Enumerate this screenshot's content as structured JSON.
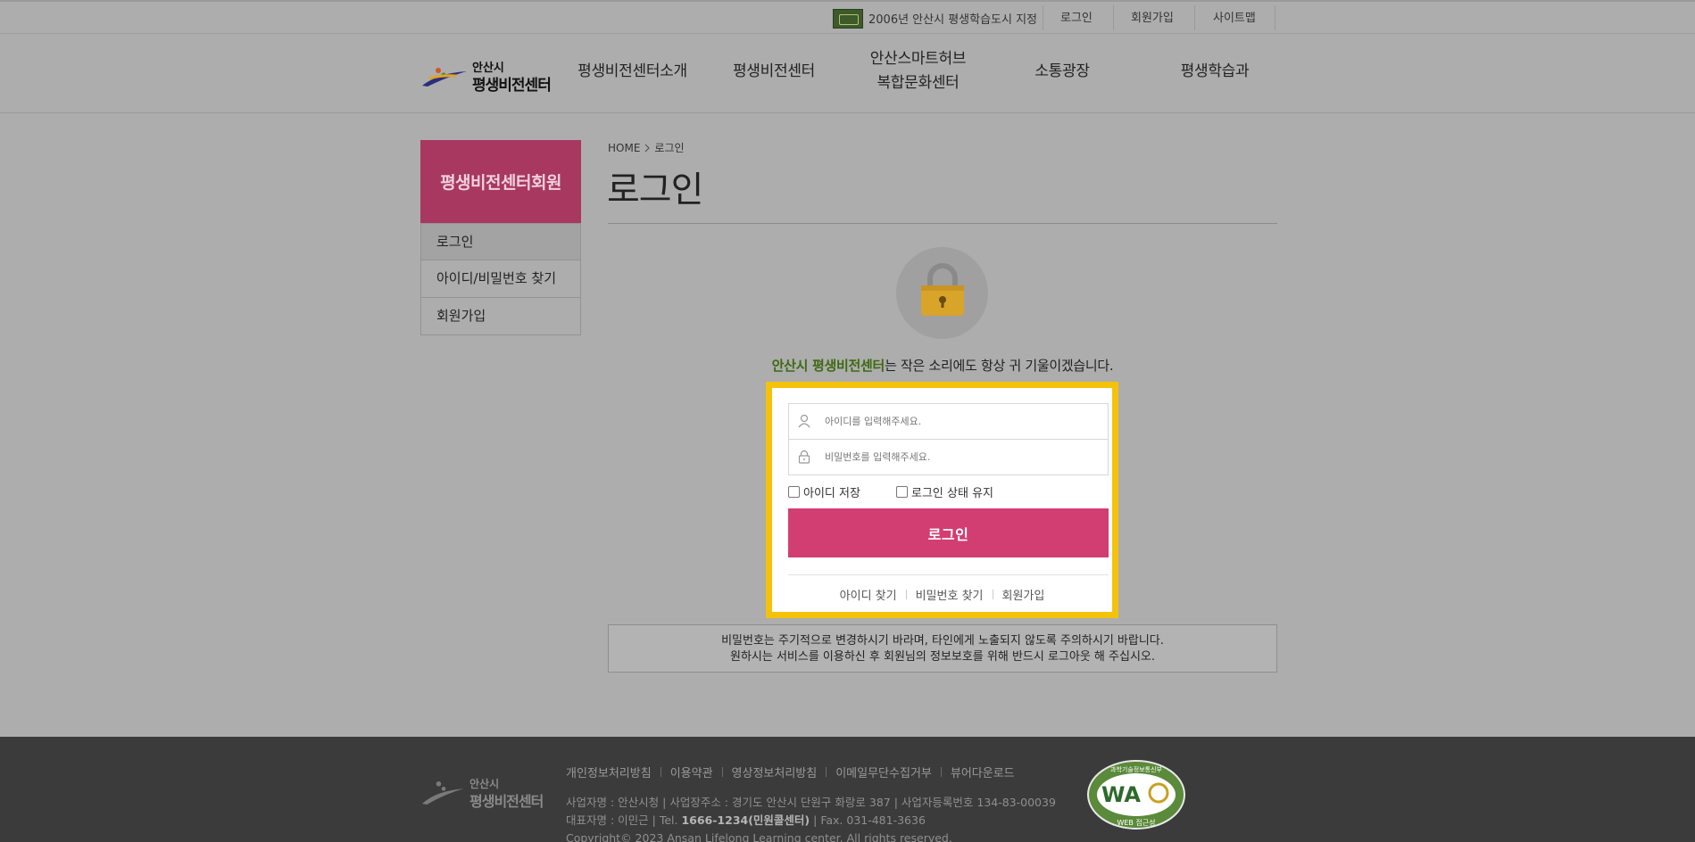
{
  "topbar": {
    "badge_text": "2006년 안산시 평생학습도시 지정",
    "links": [
      "로그인",
      "회원가입",
      "사이트맵"
    ]
  },
  "logo": {
    "line1": "안산시",
    "line2": "평생비전센터"
  },
  "nav": {
    "items": [
      {
        "label": "평생비전센터소개"
      },
      {
        "label": "평생비전센터"
      },
      {
        "label": "안산스마트허브",
        "label2": "복합문화센터"
      },
      {
        "label": "소통광장"
      },
      {
        "label": "평생학습과"
      }
    ]
  },
  "sidebar": {
    "title": "평생비전센터회원",
    "items": [
      {
        "label": "로그인",
        "active": true
      },
      {
        "label": "아이디/비밀번호 찾기"
      },
      {
        "label": "회원가입"
      }
    ]
  },
  "breadcrumb": {
    "home": "HOME",
    "current": "로그인"
  },
  "page_title": "로그인",
  "slogan": {
    "highlight": "안산시 평생비전센터",
    "rest": "는 작은 소리에도 항상 귀 기울이겠습니다."
  },
  "login_form": {
    "id_placeholder": "아이디를 입력해주세요.",
    "pw_placeholder": "비밀번호를 입력해주세요.",
    "save_id_label": "아이디 저장",
    "keep_login_label": "로그인 상태 유지",
    "login_button": "로그인",
    "find_id": "아이디 찾기",
    "find_pw": "비밀번호 찾기",
    "join": "회원가입",
    "highlight_color": "#f5c20a",
    "button_color": "#d23e71"
  },
  "notice": {
    "line1": "비밀번호는 주기적으로 변경하시기 바라며, 타인에게 노출되지 않도록 주의하시기 바랍니다.",
    "line2": "원하시는 서비스를 이용하신 후 회원님의 정보보호를 위해 반드시 로그아웃 해 주십시오."
  },
  "footer": {
    "logo_line1": "안산시",
    "logo_line2": "평생비전센터",
    "links": [
      "개인정보처리방침",
      "이용약관",
      "영상정보처리방침",
      "이메일무단수집거부",
      "뷰어다운로드"
    ],
    "address": "사업자명 : 안산시청 | 사업장주소 : 경기도 안산시 단원구 화랑로 387 | 사업자등록번호 134-83-00039",
    "rep_prefix": "대표자명 : 이민근 | Tel. ",
    "tel": "1666-1234(민원콜센터)",
    "fax": " | Fax. 031-481-3636",
    "copyright": "Copyright© 2023 Ansan Lifelong Learning center. All rights reserved.",
    "wa_top": "과학기술정보통신부",
    "wa_bottom": "WEB 접근성"
  }
}
